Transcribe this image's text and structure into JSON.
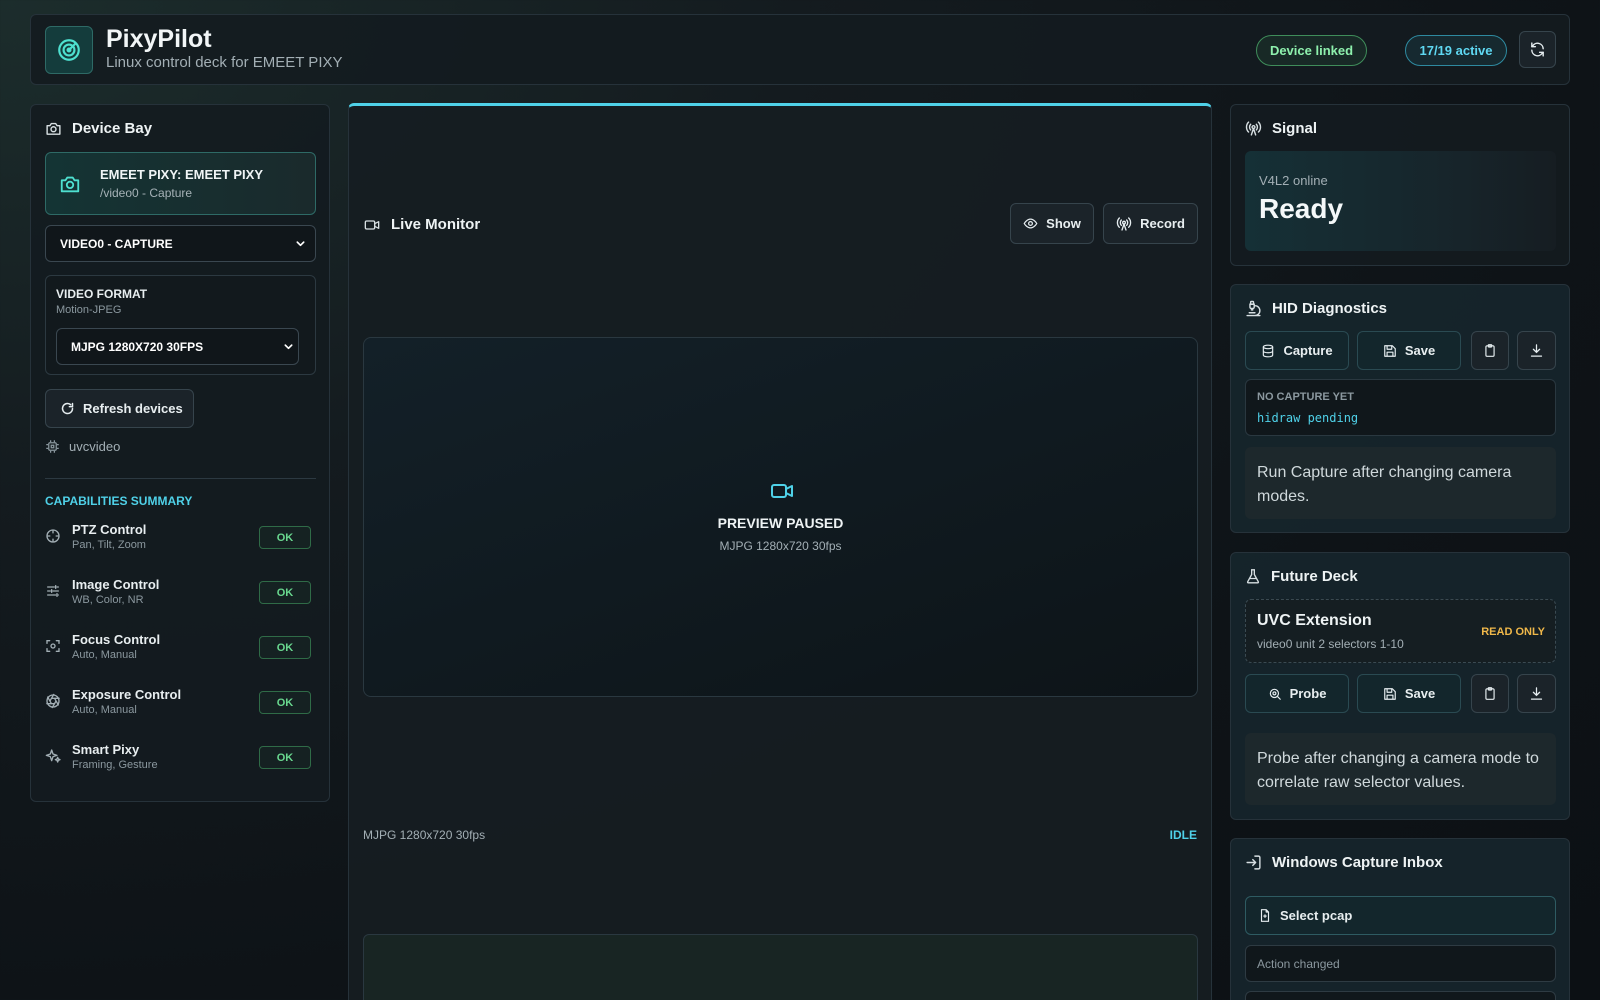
{
  "header": {
    "title": "PixyPilot",
    "subtitle": "Linux control deck for EMEET PIXY",
    "badge_linked": "Device linked",
    "badge_active": "17/19 active"
  },
  "device_bay": {
    "title": "Device Bay",
    "device_name": "EMEET PIXY: EMEET PIXY",
    "device_path": "/video0 - Capture",
    "device_select": "VIDEO0 - CAPTURE",
    "format_label": "VIDEO FORMAT",
    "format_sub": "Motion-JPEG",
    "format_select": "MJPG 1280X720 30FPS",
    "refresh_label": "Refresh devices",
    "driver": "uvcvideo",
    "capabilities_title": "CAPABILITIES SUMMARY",
    "capabilities": [
      {
        "name": "PTZ Control",
        "sub": "Pan, Tilt, Zoom",
        "status": "OK"
      },
      {
        "name": "Image Control",
        "sub": "WB, Color, NR",
        "status": "OK"
      },
      {
        "name": "Focus Control",
        "sub": "Auto, Manual",
        "status": "OK"
      },
      {
        "name": "Exposure Control",
        "sub": "Auto, Manual",
        "status": "OK"
      },
      {
        "name": "Smart Pixy",
        "sub": "Framing, Gesture",
        "status": "OK"
      }
    ]
  },
  "monitor": {
    "title": "Live Monitor",
    "show_label": "Show",
    "record_label": "Record",
    "preview_status": "PREVIEW PAUSED",
    "preview_format": "MJPG 1280x720 30fps",
    "footer_format": "MJPG 1280x720 30fps",
    "footer_state": "IDLE"
  },
  "signal": {
    "title": "Signal",
    "sub": "V4L2 online",
    "state": "Ready"
  },
  "hid": {
    "title": "HID Diagnostics",
    "capture_label": "Capture",
    "save_label": "Save",
    "status_title": "NO CAPTURE YET",
    "status_code": "hidraw pending",
    "note": "Run Capture after changing camera modes."
  },
  "future": {
    "title": "Future Deck",
    "ext_title": "UVC Extension",
    "ext_sub": "video0 unit 2 selectors 1-10",
    "ext_badge": "READ ONLY",
    "probe_label": "Probe",
    "save_label": "Save",
    "note": "Probe after changing a camera mode to correlate raw selector values."
  },
  "inbox": {
    "title": "Windows Capture Inbox",
    "select_label": "Select pcap",
    "action_placeholder": "Action changed"
  },
  "colors": {
    "accent": "#4fd1e8",
    "ok_green": "#69d88f",
    "warn_amber": "#f0b84a"
  }
}
